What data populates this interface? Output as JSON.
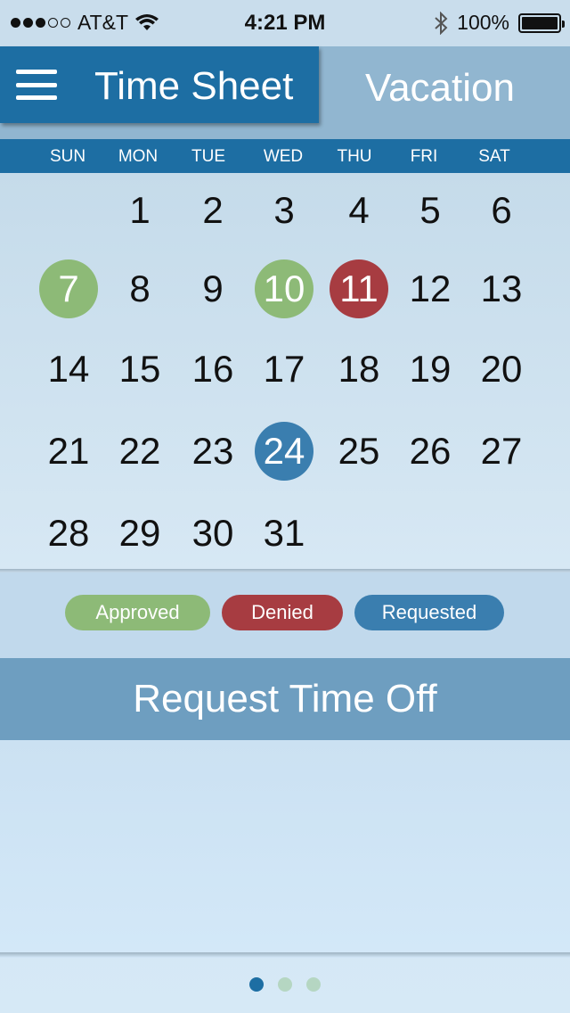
{
  "status_bar": {
    "carrier": "AT&T",
    "time": "4:21 PM",
    "battery": "100%",
    "signal_bars": 3,
    "signal_total": 5,
    "battery_level": 1.0
  },
  "header": {
    "tabs": [
      {
        "label": "Time Sheet",
        "active": true
      },
      {
        "label": "Vacation",
        "active": false
      }
    ]
  },
  "calendar": {
    "weekdays": [
      "SUN",
      "MON",
      "TUE",
      "WED",
      "THU",
      "FRI",
      "SAT"
    ],
    "first_weekday_index": 1,
    "days_in_month": 31,
    "day_labels": [
      "1",
      "2",
      "3",
      "4",
      "5",
      "6",
      "7",
      "8",
      "9",
      "10",
      "11",
      "12",
      "13",
      "14",
      "15",
      "16",
      "17",
      "18",
      "19",
      "20",
      "21",
      "22",
      "23",
      "24",
      "25",
      "26",
      "27",
      "28",
      "29",
      "30",
      "31"
    ],
    "statuses": {
      "7": "approved",
      "10": "approved",
      "11": "denied",
      "24": "requested"
    }
  },
  "legend": {
    "approved": "Approved",
    "denied": "Denied",
    "requested": "Requested"
  },
  "request_button": "Request Time Off",
  "colors": {
    "primary": "#1d6ea3",
    "approved": "#8dba77",
    "denied": "#a73c41",
    "requested": "#3a7eaf"
  },
  "pager": {
    "pages": 3,
    "active_index": 0
  }
}
